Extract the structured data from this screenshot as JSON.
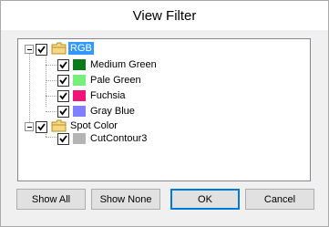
{
  "window": {
    "title": "View Filter"
  },
  "tree": {
    "groups": [
      {
        "label": "RGB",
        "checked": true,
        "selected": true,
        "items": [
          {
            "label": "Medium Green",
            "checked": true,
            "color": "#0a7a1a"
          },
          {
            "label": "Pale Green",
            "checked": true,
            "color": "#76f07a"
          },
          {
            "label": "Fuchsia",
            "checked": true,
            "color": "#f0147a"
          },
          {
            "label": "Gray Blue",
            "checked": true,
            "color": "#8080ff"
          }
        ]
      },
      {
        "label": "Spot Color",
        "checked": true,
        "selected": false,
        "items": [
          {
            "label": "CutContour3",
            "checked": true,
            "color": "#b4b4b4"
          }
        ]
      }
    ]
  },
  "buttons": {
    "show_all": "Show All",
    "show_none": "Show None",
    "ok": "OK",
    "cancel": "Cancel"
  },
  "colors": {
    "selection": "#3399ff",
    "default_button_border": "#0078d7"
  }
}
